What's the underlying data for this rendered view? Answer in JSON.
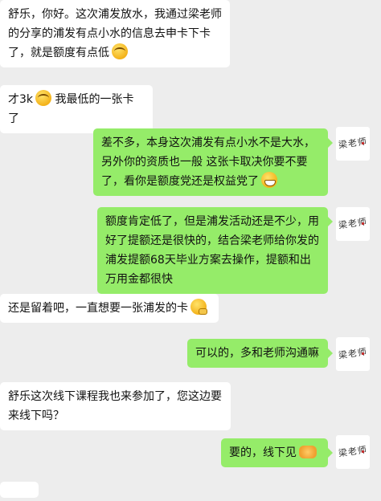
{
  "messages": [
    {
      "side": "in",
      "text": "舒乐，你好。这次浦发放水，我通过梁老师的分享的浦发有点小水的信息去申卡下卡了，就是额度有点低",
      "emoji": "laugh-cry"
    },
    {
      "side": "in",
      "text": "才3k",
      "emoji": "laugh-cry",
      "text_after": " 我最低的一张卡了"
    },
    {
      "side": "out",
      "text": "差不多，本身这次浦发有点小水不是大水，另外你的资质也一般  这张卡取决你要不要了，看你是额度党还是权益党了",
      "emoji": "grin"
    },
    {
      "side": "out",
      "text": "额度肯定低了，但是浦发活动还是不少，用好了提额还是很快的，结合梁老师给你发的浦发提额68天毕业方案去操作，提额和出万用金都很快"
    },
    {
      "side": "in",
      "text": "还是留着吧，一直想要一张浦发的卡",
      "emoji": "thinking"
    },
    {
      "side": "out",
      "text": "可以的，多和老师沟通嘛"
    },
    {
      "side": "in",
      "text": "舒乐这次线下课程我也来参加了，您这边要来线下吗？"
    },
    {
      "side": "out",
      "text": "要的，线下见",
      "emoji": "handshake"
    }
  ],
  "avatar": {
    "label": "梁老师",
    "mark": "logo-seal"
  }
}
